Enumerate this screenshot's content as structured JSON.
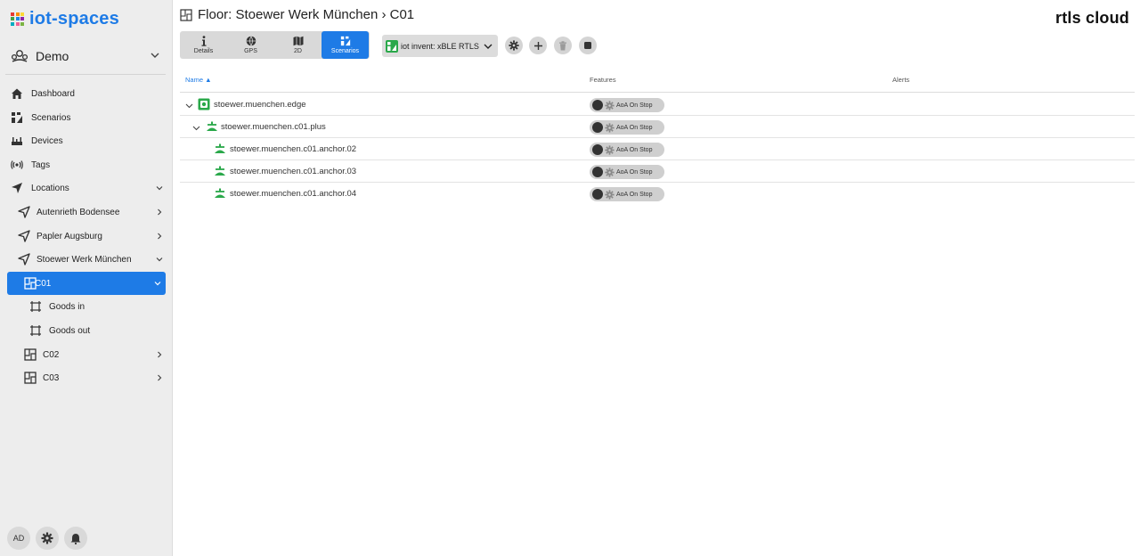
{
  "app": {
    "name": "iot-spaces",
    "brand_right": "rtls cloud"
  },
  "tenant": {
    "name": "Demo"
  },
  "nav": {
    "dashboard": "Dashboard",
    "scenarios": "Scenarios",
    "devices": "Devices",
    "tags": "Tags",
    "locations": "Locations",
    "loc1": "Autenrieth Bodensee",
    "loc2": "Papler Augsburg",
    "loc3": "Stoewer Werk München",
    "floor_c01": "C01",
    "zone_in": "Goods in",
    "zone_out": "Goods out",
    "floor_c02": "C02",
    "floor_c03": "C03"
  },
  "user": {
    "initials": "AD"
  },
  "header": {
    "title": "Floor: Stoewer Werk München › C01"
  },
  "view_tabs": {
    "details": "Details",
    "gps": "GPS",
    "2d": "2D",
    "scenarios": "Scenarios"
  },
  "toolbar": {
    "scenario": "iot invent: xBLE RTLS"
  },
  "table": {
    "col_name": "Name",
    "col_features": "Features",
    "col_alerts": "Alerts",
    "rows": [
      {
        "name": "stoewer.muenchen.edge",
        "feature": "AoA On Stop"
      },
      {
        "name": "stoewer.muenchen.c01.plus",
        "feature": "AoA On Stop"
      },
      {
        "name": "stoewer.muenchen.c01.anchor.02",
        "feature": "AoA On Stop"
      },
      {
        "name": "stoewer.muenchen.c01.anchor.03",
        "feature": "AoA On Stop"
      },
      {
        "name": "stoewer.muenchen.c01.anchor.04",
        "feature": "AoA On Stop"
      }
    ]
  },
  "colors": {
    "accent": "#1e7be6",
    "sidebar_bg": "#ededed",
    "device_green": "#2aa84a"
  },
  "icons": [
    "grid-logo-icon",
    "users-icon",
    "home-icon",
    "scenarios-icon",
    "devices-icon",
    "tags-icon",
    "navigation-icon",
    "floor-icon",
    "zone-icon",
    "gear-icon",
    "bell-icon",
    "plus-icon",
    "trash-icon",
    "stop-icon",
    "chevron-down-icon",
    "chevron-right-icon",
    "edge-device-icon",
    "anchor-icon"
  ]
}
